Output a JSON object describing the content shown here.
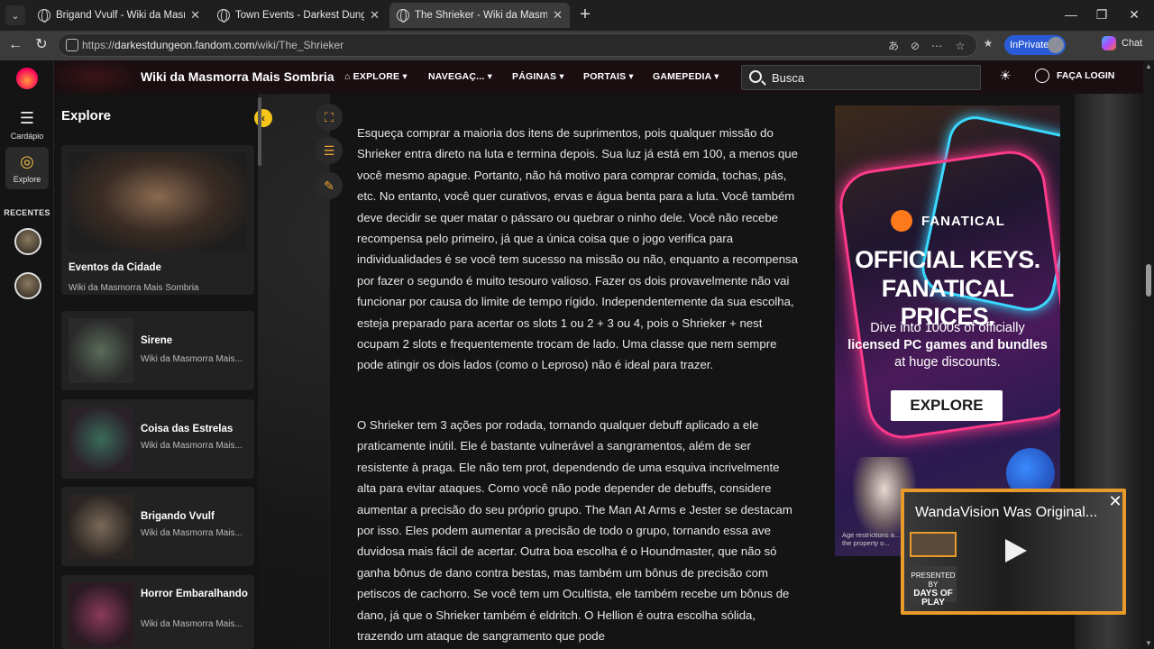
{
  "browser": {
    "tabs": [
      {
        "title": "Brigand Vvulf - Wiki da Masmorra",
        "active": false
      },
      {
        "title": "Town Events - Darkest Dungeon W",
        "active": false
      },
      {
        "title": "The Shrieker - Wiki da Masmorra M",
        "active": true
      }
    ],
    "url_prefix": "https://",
    "url_host": "darkestdungeon.fandom.com",
    "url_path": "/wiki/The_Shrieker",
    "inprivate_label": "InPrivate",
    "chat_label": "Chat",
    "accent_color": "#2a5bd7"
  },
  "fandom_rail": {
    "menu_label": "Cardápio",
    "explore_label": "Explore",
    "recents_label": "RECENTES"
  },
  "topnav": {
    "wiki_title": "Wiki da Masmorra Mais Sombria",
    "links": [
      "EXPLORE",
      "NAVEGAÇ...",
      "PÁGINAS",
      "PORTAIS",
      "GAMEPEDIA"
    ],
    "search_placeholder": "Busca",
    "login_label": "FAÇA LOGIN"
  },
  "explore_panel": {
    "title": "Explore",
    "featured": {
      "title": "Eventos da Cidade",
      "subtitle": "Wiki da Masmorra Mais Sombria"
    },
    "cards": [
      {
        "title": "Sirene",
        "subtitle": "Wiki da Masmorra Mais..."
      },
      {
        "title": "Coisa das Estrelas",
        "subtitle": "Wiki da Masmorra Mais..."
      },
      {
        "title": "Brigando Vvulf",
        "subtitle": "Wiki da Masmorra Mais..."
      },
      {
        "title": "Horror Embaralhando",
        "subtitle": "Wiki da Masmorra Mais..."
      }
    ]
  },
  "article": {
    "paragraph1": "Esqueça comprar a maioria dos itens de suprimentos, pois qualquer missão do Shrieker entra direto na luta e termina depois. Sua luz já está em 100, a menos que você mesmo apague. Portanto, não há motivo para comprar comida, tochas, pás, etc. No entanto, você quer curativos, ervas e água benta para a luta. Você também deve decidir se quer matar o pássaro ou quebrar o ninho dele. Você não recebe recompensa pelo primeiro, já que a única coisa que o jogo verifica para individualidades é se você tem sucesso na missão ou não, enquanto a recompensa por fazer o segundo é muito tesouro valioso. Fazer os dois provavelmente não vai funcionar por causa do limite de tempo rígido. Independentemente da sua escolha, esteja preparado para acertar os slots 1 ou 2 + 3 ou 4, pois o Shrieker + nest ocupam 2 slots e frequentemente trocam de lado. Uma classe que nem sempre pode atingir os dois lados (como o Leproso) não é ideal para trazer.",
    "paragraph2": "O Shrieker tem 3 ações por rodada, tornando qualquer debuff aplicado a ele praticamente inútil. Ele é bastante vulnerável a sangramentos, além de ser resistente à praga. Ele não tem prot, dependendo de uma esquiva incrivelmente alta para evitar ataques. Como você não pode depender de debuffs, considere aumentar a precisão do seu próprio grupo. The Man At Arms e Jester se destacam por isso. Eles podem aumentar a precisão de todo o grupo, tornando essa ave duvidosa mais fácil de acertar. Outra boa escolha é o Houndmaster, que não só ganha bônus de dano contra bestas, mas também um bônus de precisão com petiscos de cachorro. Se você tem um Ocultista, ele também recebe um bônus de dano, já que o Shrieker também é eldritch. O Hellion é outra escolha sólida, trazendo um ataque de sangramento que pode"
  },
  "ad": {
    "brand": "FANATICAL",
    "headline1": "OFFICIAL KEYS.",
    "headline2": "FANATICAL PRICES.",
    "subline_1": "Dive into 1000s of officially",
    "subline_2": "licensed PC games and bundles",
    "subline_3": "at huge discounts.",
    "cta": "EXPLORE",
    "legal": "Age restrictions a... are the property o..."
  },
  "video": {
    "title": "WandaVision Was Original...",
    "days_small": "PRESENTED BY",
    "days_big": "DAYS OF PLAY"
  }
}
